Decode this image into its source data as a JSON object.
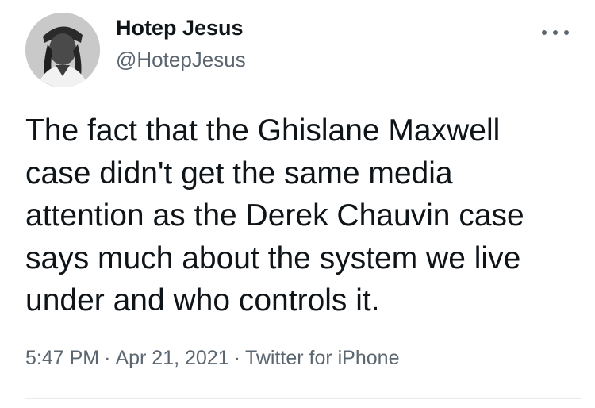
{
  "tweet": {
    "author": {
      "display_name": "Hotep Jesus",
      "handle": "@HotepJesus",
      "avatar_icon": "profile-photo"
    },
    "more_icon": "more-options-icon",
    "text_lines": [
      "The fact that the Ghislane Maxwell",
      "case didn't get the same media",
      "attention as the Derek Chauvin case",
      "says much about the system we live",
      "under and who controls it."
    ],
    "time": "5:47 PM",
    "date": "Apr 21, 2021",
    "source": "Twitter for iPhone",
    "separator": "·"
  }
}
